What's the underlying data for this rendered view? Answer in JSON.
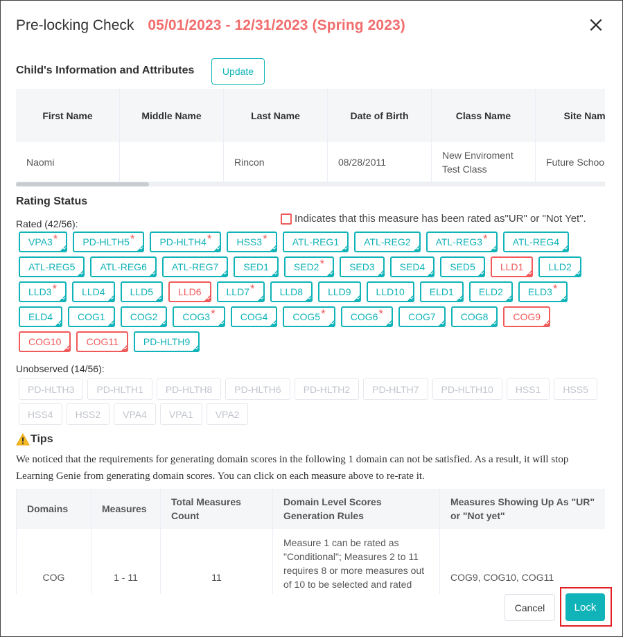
{
  "dialog": {
    "title": "Pre-locking Check",
    "date_range": "05/01/2023 - 12/31/2023 (Spring 2023)"
  },
  "child_info": {
    "section_title": "Child's Information and Attributes",
    "update_label": "Update",
    "columns": [
      "First Name",
      "Middle Name",
      "Last Name",
      "Date of Birth",
      "Class Name",
      "Site Name"
    ],
    "row": [
      "Naomi",
      "",
      "Rincon",
      "08/28/2011",
      "New Enviroment Test Class",
      "Future School"
    ]
  },
  "rating_status": {
    "section_title": "Rating Status",
    "legend_text": "Indicates that this measure has been rated as\"UR\" or \"Not Yet\".",
    "rated_label": "Rated (42/56):",
    "rated": [
      {
        "label": "VPA3",
        "star": true,
        "red": false
      },
      {
        "label": "PD-HLTH5",
        "star": true,
        "red": false
      },
      {
        "label": "PD-HLTH4",
        "star": true,
        "red": false
      },
      {
        "label": "HSS3",
        "star": true,
        "red": false
      },
      {
        "label": "ATL-REG1",
        "star": false,
        "red": false
      },
      {
        "label": "ATL-REG2",
        "star": false,
        "red": false
      },
      {
        "label": "ATL-REG3",
        "star": true,
        "red": false
      },
      {
        "label": "ATL-REG4",
        "star": false,
        "red": false
      },
      {
        "label": "ATL-REG5",
        "star": false,
        "red": false
      },
      {
        "label": "ATL-REG6",
        "star": false,
        "red": false
      },
      {
        "label": "ATL-REG7",
        "star": false,
        "red": false
      },
      {
        "label": "SED1",
        "star": false,
        "red": false
      },
      {
        "label": "SED2",
        "star": true,
        "red": false
      },
      {
        "label": "SED3",
        "star": false,
        "red": false
      },
      {
        "label": "SED4",
        "star": false,
        "red": false
      },
      {
        "label": "SED5",
        "star": false,
        "red": false
      },
      {
        "label": "LLD1",
        "star": false,
        "red": true
      },
      {
        "label": "LLD2",
        "star": false,
        "red": false
      },
      {
        "label": "LLD3",
        "star": true,
        "red": false
      },
      {
        "label": "LLD4",
        "star": false,
        "red": false
      },
      {
        "label": "LLD5",
        "star": false,
        "red": false
      },
      {
        "label": "LLD6",
        "star": false,
        "red": true
      },
      {
        "label": "LLD7",
        "star": true,
        "red": false
      },
      {
        "label": "LLD8",
        "star": false,
        "red": false
      },
      {
        "label": "LLD9",
        "star": false,
        "red": false
      },
      {
        "label": "LLD10",
        "star": false,
        "red": false
      },
      {
        "label": "ELD1",
        "star": false,
        "red": false
      },
      {
        "label": "ELD2",
        "star": false,
        "red": false
      },
      {
        "label": "ELD3",
        "star": true,
        "red": false
      },
      {
        "label": "ELD4",
        "star": false,
        "red": false
      },
      {
        "label": "COG1",
        "star": false,
        "red": false
      },
      {
        "label": "COG2",
        "star": false,
        "red": false
      },
      {
        "label": "COG3",
        "star": true,
        "red": false
      },
      {
        "label": "COG4",
        "star": false,
        "red": false
      },
      {
        "label": "COG5",
        "star": true,
        "red": false
      },
      {
        "label": "COG6",
        "star": true,
        "red": false
      },
      {
        "label": "COG7",
        "star": false,
        "red": false
      },
      {
        "label": "COG8",
        "star": false,
        "red": false
      },
      {
        "label": "COG9",
        "star": false,
        "red": true
      },
      {
        "label": "COG10",
        "star": false,
        "red": true
      },
      {
        "label": "COG11",
        "star": false,
        "red": true
      },
      {
        "label": "PD-HLTH9",
        "star": false,
        "red": false
      }
    ],
    "unobserved_label": "Unobserved (14/56):",
    "unobserved": [
      "PD-HLTH3",
      "PD-HLTH1",
      "PD-HLTH8",
      "PD-HLTH6",
      "PD-HLTH2",
      "PD-HLTH7",
      "PD-HLTH10",
      "HSS1",
      "HSS5",
      "HSS4",
      "HSS2",
      "VPA4",
      "VPA1",
      "VPA2"
    ]
  },
  "tips": {
    "title": "Tips",
    "text": "We noticed that the requirements for generating domain scores in the following 1 domain can not be satisfied. As a result, it will stop Learning Genie from generating domain scores. You can click on each measure above to re-rate it.",
    "columns": [
      "Domains",
      "Measures",
      "Total Measures Count",
      "Domain Level Scores Generation Rules",
      "Measures Showing Up As \"UR\" or \"Not yet\""
    ],
    "row": [
      "COG",
      "1 - 11",
      "11",
      "Measure 1 can be rated as \"Conditional\"; Measures 2 to 11 requires 8 or more measures out of 10 to be selected and rated",
      "COG9, COG10, COG11"
    ]
  },
  "footer": {
    "cancel_label": "Cancel",
    "lock_label": "Lock"
  },
  "colors": {
    "accent": "#10b3b7",
    "warning": "#f05a5a",
    "date_range": "#f16c6c",
    "highlight_outline": "#e31e24"
  }
}
